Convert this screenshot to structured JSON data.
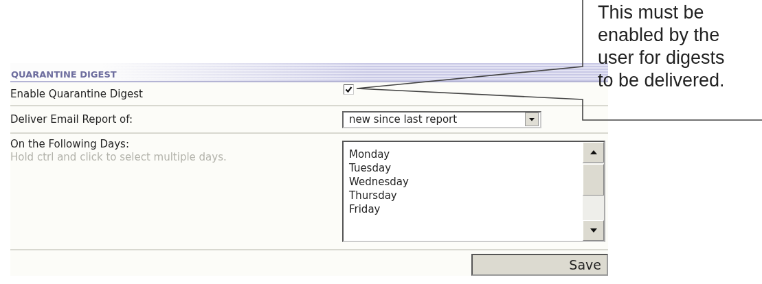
{
  "section": {
    "title": "QUARANTINE DIGEST"
  },
  "fields": [
    {
      "kind": "checkbox",
      "label": "Enable Quarantine Digest",
      "checked": true
    },
    {
      "kind": "dropdown",
      "label": "Deliver Email Report of:",
      "value": "new since last report"
    },
    {
      "kind": "listbox",
      "label": "On the Following Days:",
      "hint": "Hold ctrl and click to select multiple days.",
      "options": [
        "Monday",
        "Tuesday",
        "Wednesday",
        "Thursday",
        "Friday"
      ]
    }
  ],
  "save_button": "Save",
  "callout": {
    "text": "This must be enabled by the user for digests to be delivered."
  }
}
